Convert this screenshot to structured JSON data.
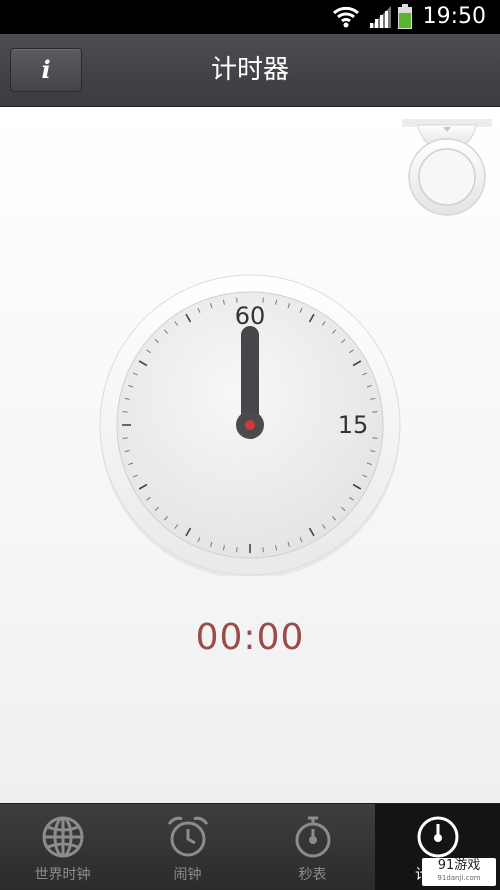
{
  "status_bar": {
    "time": "19:50",
    "icons": [
      "wifi-icon",
      "signal-icon",
      "battery-icon"
    ],
    "battery_color": "#5cb531"
  },
  "header": {
    "info_button_label": "i",
    "title": "计时器"
  },
  "dial": {
    "top_label": "60",
    "right_label": "15",
    "hand_value": 0,
    "center_color": "#d03a36"
  },
  "timer": {
    "elapsed": "00:00",
    "color": "#9c4b4b"
  },
  "nav": {
    "items": [
      {
        "label": "世界时钟",
        "icon": "globe-icon",
        "active": false
      },
      {
        "label": "闹钟",
        "icon": "alarm-clock-icon",
        "active": false
      },
      {
        "label": "秒表",
        "icon": "stopwatch-icon",
        "active": false
      },
      {
        "label": "计",
        "icon": "timer-icon",
        "active": true
      }
    ]
  },
  "watermark": {
    "text": "91游戏",
    "sub": "91danji.com"
  }
}
